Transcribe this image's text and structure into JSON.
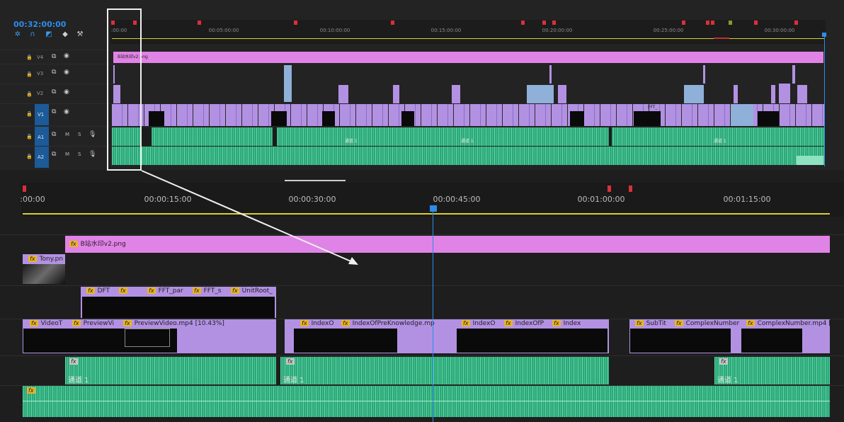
{
  "top": {
    "timecode": "00:32:00:00",
    "ruler_labels": [
      ":00:00",
      "00:05:00:00",
      "00:10:00:00",
      "00:15:00:00",
      "00:20:00:00",
      "00:25:00:00",
      "00:30:00:00"
    ],
    "tracks": [
      {
        "lock": "🔒",
        "name": "V4"
      },
      {
        "lock": "🔒",
        "name": "V3"
      },
      {
        "lock": "🔒",
        "name": "V2"
      },
      {
        "lock": "🔒",
        "name": "V1"
      },
      {
        "lock": "🔒",
        "name": "A1",
        "m": "M",
        "s": "S"
      },
      {
        "lock": "🔒",
        "name": "A2",
        "m": "M",
        "s": "S"
      }
    ],
    "v4_clip": "B站水印v2.png",
    "small_fft": "FFT_",
    "small_channel": "通道 1"
  },
  "bottom": {
    "ruler_labels": [
      ":00:00",
      "00:00:15:00",
      "00:00:30:00",
      "00:00:45:00",
      "00:01:00:00",
      "00:01:15:00"
    ],
    "clips": {
      "watermark": "B站水印v2.png",
      "tony": "Tony.pn",
      "dft": "DFT",
      "fft_par": "FFT_par",
      "fft_s": "FFT_s",
      "unitroot": "UnitRoot_",
      "videot": "VideoT",
      "previewvi": "PreviewVi",
      "previewvideo": "PreviewVideo.mp4 [10.43%]",
      "indexo1": "IndexO",
      "indexofpre": "IndexOfPreKnowledge.mp4",
      "indexo2": "IndexO",
      "indexofp": "IndexOfP",
      "index": "Index",
      "subtit": "SubTit",
      "complexnumber": "ComplexNumber",
      "complexnumber_mp4": "ComplexNumber.mp4 [",
      "channel": "通道 1"
    }
  },
  "colors": {
    "video": "#b291e3",
    "audio": "#2fa77a",
    "title_clip": "#e083e6",
    "playhead": "#2d8ceb"
  }
}
